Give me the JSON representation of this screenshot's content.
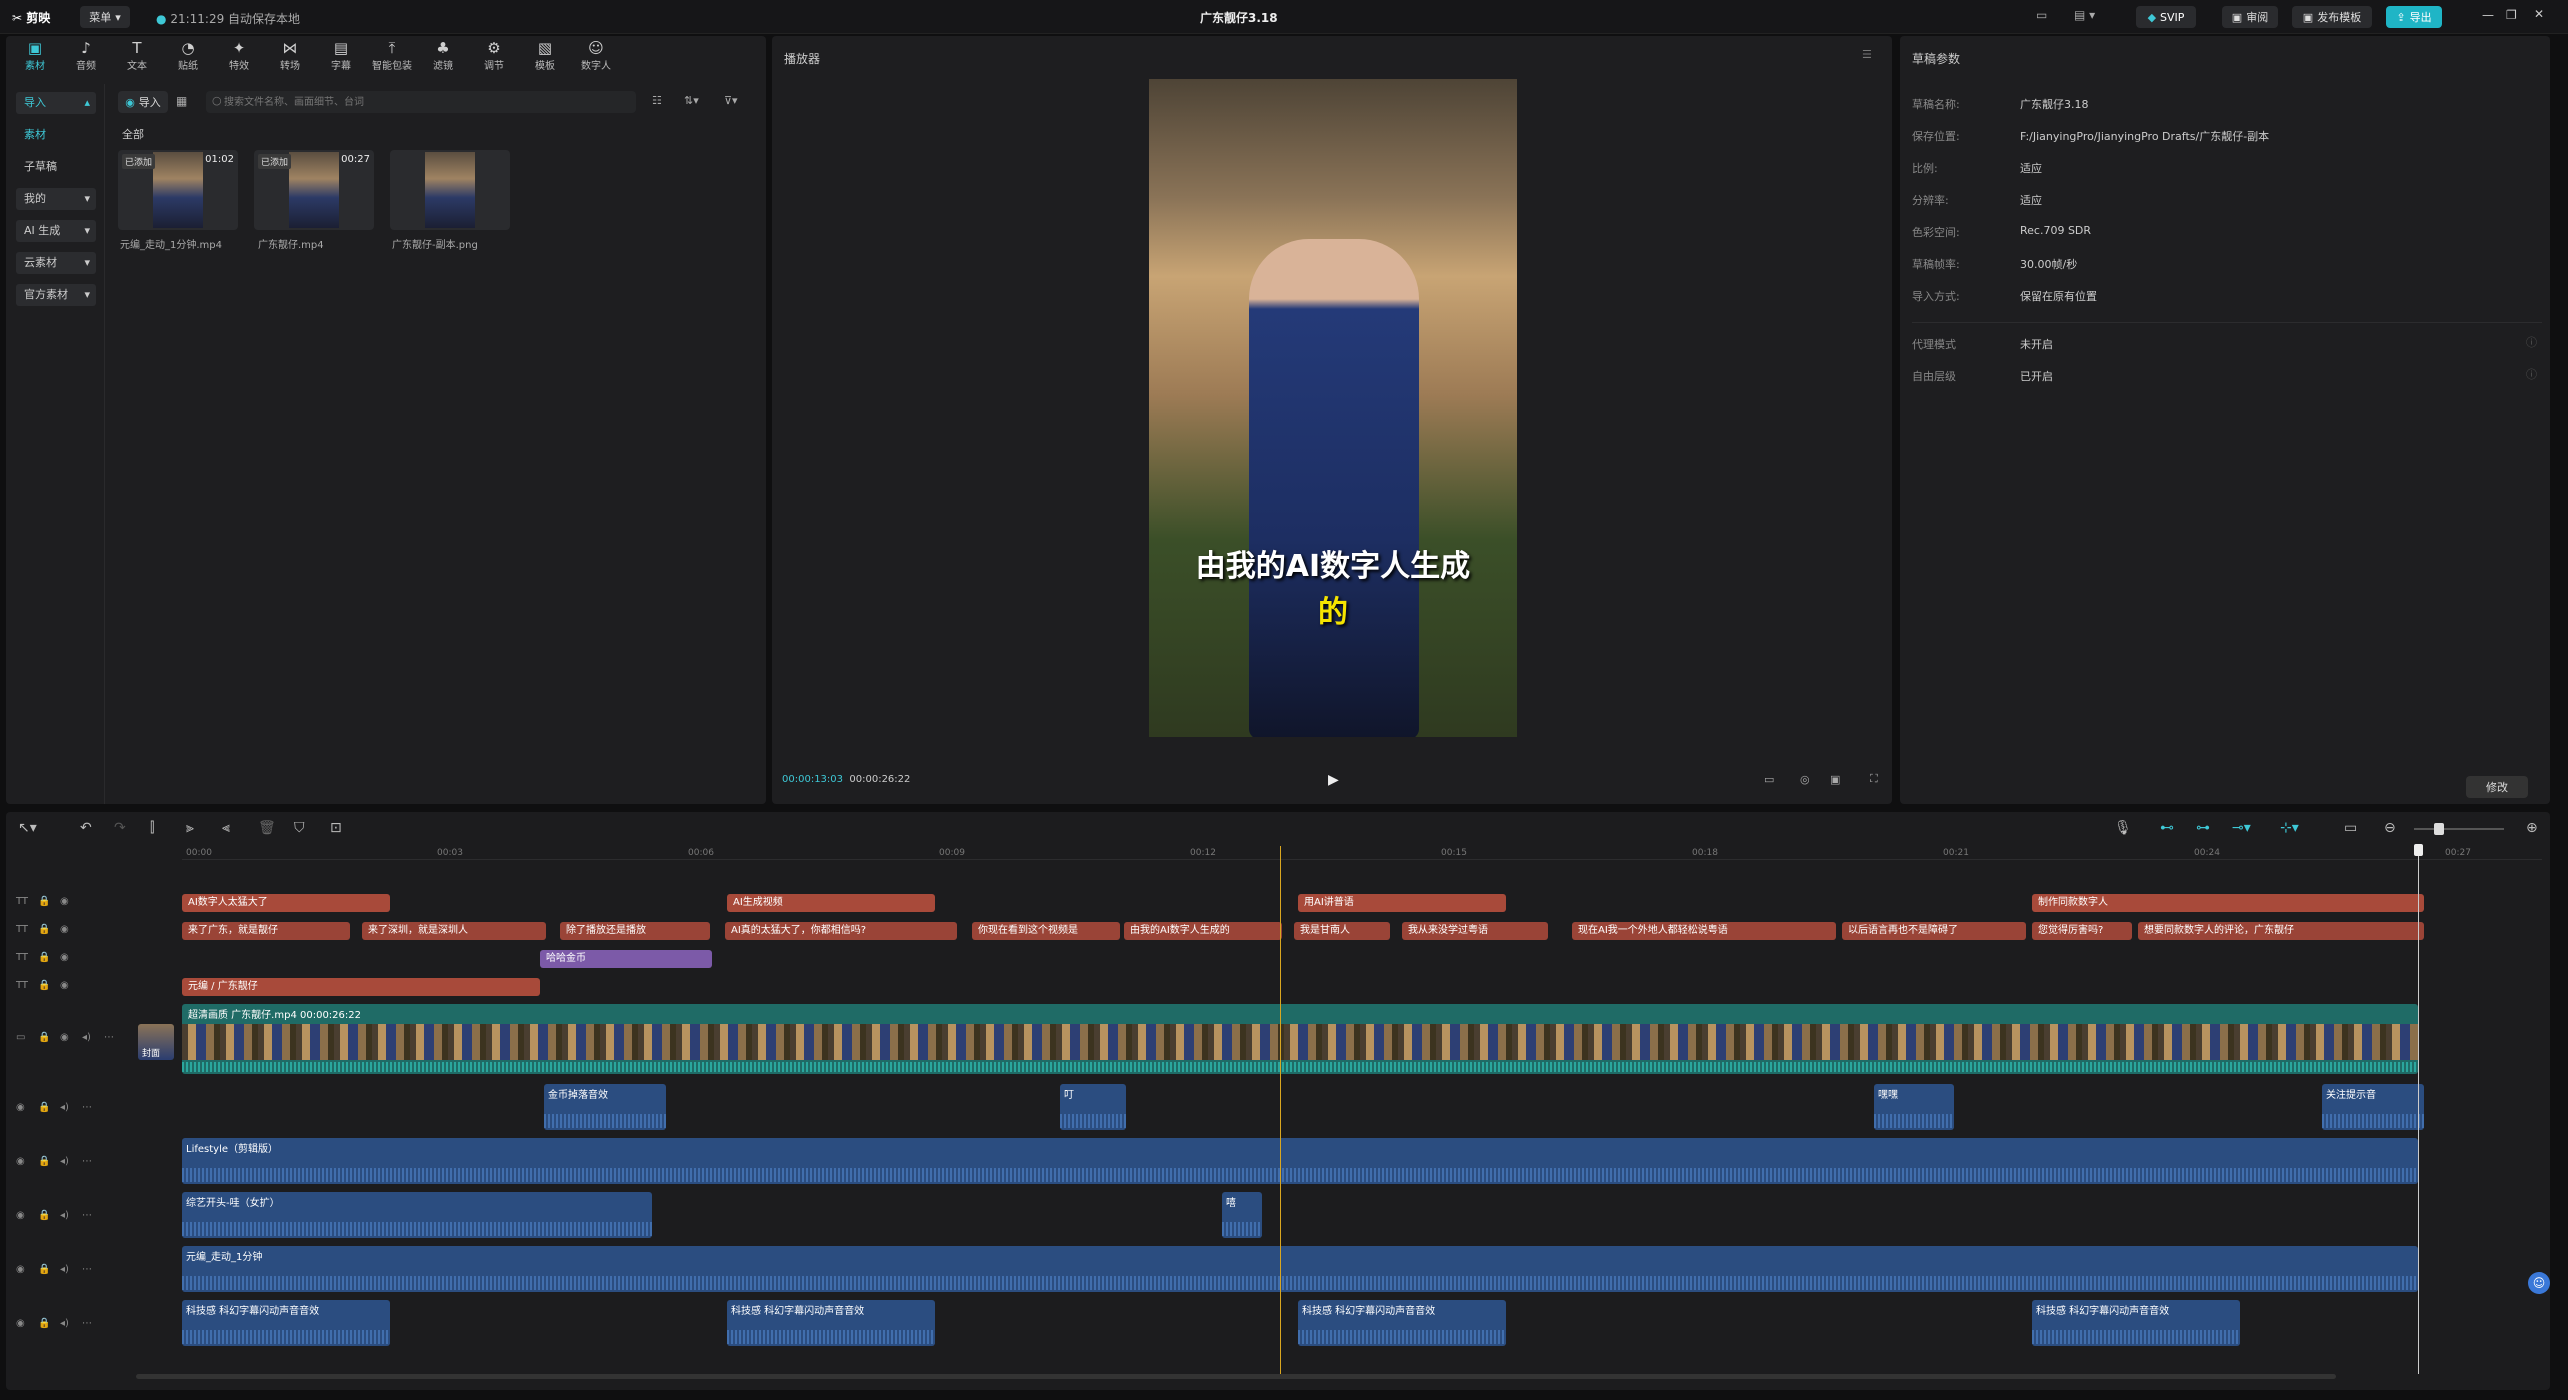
{
  "app": {
    "logo": "剪映",
    "menu_label": "菜单",
    "autosave": "21:11:29 自动保存本地",
    "title": "广东靓仔3.18",
    "svip": "SVIP",
    "review": "审阅",
    "publish_template": "发布模板",
    "export": "导出"
  },
  "toolbar": {
    "items": [
      {
        "label": "素材",
        "icon": "media-icon"
      },
      {
        "label": "音频",
        "icon": "audio-icon"
      },
      {
        "label": "文本",
        "icon": "text-icon"
      },
      {
        "label": "贴纸",
        "icon": "sticker-icon"
      },
      {
        "label": "特效",
        "icon": "effects-icon"
      },
      {
        "label": "转场",
        "icon": "transition-icon"
      },
      {
        "label": "字幕",
        "icon": "subtitle-icon"
      },
      {
        "label": "智能包装",
        "icon": "smart-pack-icon"
      },
      {
        "label": "滤镜",
        "icon": "filter-icon"
      },
      {
        "label": "调节",
        "icon": "adjust-icon"
      },
      {
        "label": "模板",
        "icon": "template-icon"
      },
      {
        "label": "数字人",
        "icon": "digital-human-icon"
      }
    ]
  },
  "sidebar": {
    "import": "导入",
    "media": "素材",
    "subdraft": "子草稿",
    "mine": "我的",
    "ai_gen": "AI 生成",
    "cloud": "云素材",
    "official": "官方素材"
  },
  "media_panel": {
    "import_button": "导入",
    "search_placeholder": "搜索文件名称、画面细节、台词",
    "all_label": "全部",
    "items": [
      {
        "name": "元编_走动_1分钟.mp4",
        "badge": "已添加",
        "duration": "01:02"
      },
      {
        "name": "广东靓仔.mp4",
        "badge": "已添加",
        "duration": "00:27"
      },
      {
        "name": "广东靓仔-副本.png",
        "badge": "",
        "duration": ""
      }
    ]
  },
  "player": {
    "title": "播放器",
    "subtitle_line1": "由我的AI数字人生成",
    "subtitle_line2": "的",
    "current_time": "00:00:13:03",
    "total_time": "00:00:26:22"
  },
  "draft_params": {
    "title": "草稿参数",
    "rows": [
      {
        "label": "草稿名称:",
        "value": "广东靓仔3.18"
      },
      {
        "label": "保存位置:",
        "value": "F:/JianyingPro/JianyingPro Drafts/广东靓仔-副本"
      },
      {
        "label": "比例:",
        "value": "适应"
      },
      {
        "label": "分辨率:",
        "value": "适应"
      },
      {
        "label": "色彩空间:",
        "value": "Rec.709 SDR"
      },
      {
        "label": "草稿帧率:",
        "value": "30.00帧/秒"
      },
      {
        "label": "导入方式:",
        "value": "保留在原有位置"
      },
      {
        "label": "代理模式",
        "value": "未开启"
      },
      {
        "label": "自由层级",
        "value": "已开启"
      }
    ],
    "modify_button": "修改"
  },
  "timeline": {
    "ruler": [
      "00:00",
      "00:03",
      "00:06",
      "00:09",
      "00:12",
      "00:15",
      "00:18",
      "00:21",
      "00:24",
      "00:27"
    ],
    "title_track": [
      {
        "text": "AI数字人太猛大了",
        "start": 0,
        "width": 208
      },
      {
        "text": "AI生成视频",
        "start": 545,
        "width": 208
      },
      {
        "text": "用AI讲普语",
        "start": 1116,
        "width": 208
      },
      {
        "text": "制作同款数字人",
        "start": 1850,
        "width": 392
      }
    ],
    "subtitle_track": [
      {
        "text": "来了广东，就是靓仔",
        "start": 0,
        "width": 168
      },
      {
        "text": "来了深圳，就是深圳人",
        "start": 180,
        "width": 184
      },
      {
        "text": "除了播放还是播放",
        "start": 378,
        "width": 150
      },
      {
        "text": "AI真的太猛大了，你都相信吗?",
        "start": 543,
        "width": 232
      },
      {
        "text": "你现在看到这个视频是",
        "start": 790,
        "width": 148
      },
      {
        "text": "由我的AI数字人生成的",
        "start": 942,
        "width": 158
      },
      {
        "text": "我是甘南人",
        "start": 1112,
        "width": 96
      },
      {
        "text": "我从来没学过粤语",
        "start": 1220,
        "width": 146
      },
      {
        "text": "现在AI我一个外地人都轻松说粤语",
        "start": 1390,
        "width": 264
      },
      {
        "text": "以后语言再也不是障碍了",
        "start": 1660,
        "width": 184
      },
      {
        "text": "您觉得厉害吗?",
        "start": 1850,
        "width": 100
      },
      {
        "text": "想要同款数字人的评论，广东靓仔",
        "start": 1956,
        "width": 286
      }
    ],
    "sticker_track": [
      {
        "text": "哈哈金币",
        "start": 358,
        "width": 172
      }
    ],
    "text_track": [
      {
        "text": "元编 / 广东靓仔",
        "start": 0,
        "width": 358
      }
    ],
    "main_video_label": "超清画质  广东靓仔.mp4  00:00:26:22",
    "cover_label": "封面",
    "sfx_track": [
      {
        "text": "金币掉落音效",
        "start": 362,
        "width": 122
      },
      {
        "text": "叮",
        "start": 878,
        "width": 66
      },
      {
        "text": "嘿嘿",
        "start": 1692,
        "width": 80
      },
      {
        "text": "关注提示音",
        "start": 2140,
        "width": 102
      }
    ],
    "music1": "Lifestyle（剪辑版）",
    "sfx2": [
      {
        "text": "综艺开头-哇（女扩）",
        "start": 0,
        "width": 470
      },
      {
        "text": "嘻",
        "start": 1040,
        "width": 40
      }
    ],
    "music2": "元编_走动_1分钟",
    "sfx3": [
      {
        "text": "科技感 科幻字幕闪动声音音效",
        "start": 0,
        "width": 208
      },
      {
        "text": "科技感 科幻字幕闪动声音音效",
        "start": 545,
        "width": 208
      },
      {
        "text": "科技感 科幻字幕闪动声音音效",
        "start": 1116,
        "width": 208
      },
      {
        "text": "科技感 科幻字幕闪动声音音效",
        "start": 1850,
        "width": 208
      }
    ]
  }
}
